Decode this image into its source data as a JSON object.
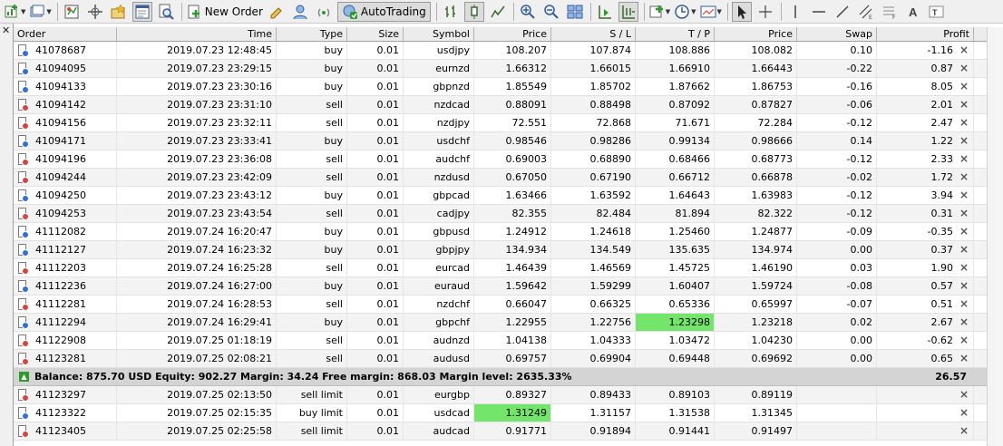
{
  "toolbar": {
    "new_order_label": "New Order",
    "autotrading_label": "AutoTrading"
  },
  "colors": {
    "buy_dot": "#2f6fd6",
    "sell_dot": "#d6453b",
    "highlight": "#72e56a"
  },
  "columns": [
    "Order",
    "Time",
    "Type",
    "Size",
    "Symbol",
    "Price",
    "S / L",
    "T / P",
    "Price",
    "Swap",
    "Profit"
  ],
  "orders": [
    {
      "order": "41078687",
      "time": "2019.07.23 12:48:45",
      "type": "buy",
      "size": "0.01",
      "symbol": "usdjpy",
      "price": "108.207",
      "sl": "107.874",
      "tp": "108.886",
      "price2": "108.082",
      "swap": "0.10",
      "profit": "-1.16"
    },
    {
      "order": "41094095",
      "time": "2019.07.23 23:29:15",
      "type": "buy",
      "size": "0.01",
      "symbol": "eurnzd",
      "price": "1.66312",
      "sl": "1.66015",
      "tp": "1.66910",
      "price2": "1.66443",
      "swap": "-0.22",
      "profit": "0.87"
    },
    {
      "order": "41094133",
      "time": "2019.07.23 23:30:16",
      "type": "buy",
      "size": "0.01",
      "symbol": "gbpnzd",
      "price": "1.85549",
      "sl": "1.85702",
      "tp": "1.87662",
      "price2": "1.86753",
      "swap": "-0.16",
      "profit": "8.05"
    },
    {
      "order": "41094142",
      "time": "2019.07.23 23:31:10",
      "type": "sell",
      "size": "0.01",
      "symbol": "nzdcad",
      "price": "0.88091",
      "sl": "0.88498",
      "tp": "0.87092",
      "price2": "0.87827",
      "swap": "-0.06",
      "profit": "2.01"
    },
    {
      "order": "41094156",
      "time": "2019.07.23 23:32:11",
      "type": "sell",
      "size": "0.01",
      "symbol": "nzdjpy",
      "price": "72.551",
      "sl": "72.868",
      "tp": "71.671",
      "price2": "72.284",
      "swap": "-0.12",
      "profit": "2.47"
    },
    {
      "order": "41094171",
      "time": "2019.07.23 23:33:41",
      "type": "buy",
      "size": "0.01",
      "symbol": "usdchf",
      "price": "0.98546",
      "sl": "0.98286",
      "tp": "0.99134",
      "price2": "0.98666",
      "swap": "0.14",
      "profit": "1.22"
    },
    {
      "order": "41094196",
      "time": "2019.07.23 23:36:08",
      "type": "sell",
      "size": "0.01",
      "symbol": "audchf",
      "price": "0.69003",
      "sl": "0.68890",
      "tp": "0.68466",
      "price2": "0.68773",
      "swap": "-0.12",
      "profit": "2.33"
    },
    {
      "order": "41094244",
      "time": "2019.07.23 23:42:09",
      "type": "sell",
      "size": "0.01",
      "symbol": "nzdusd",
      "price": "0.67050",
      "sl": "0.67190",
      "tp": "0.66712",
      "price2": "0.66878",
      "swap": "-0.02",
      "profit": "1.72"
    },
    {
      "order": "41094250",
      "time": "2019.07.23 23:43:12",
      "type": "buy",
      "size": "0.01",
      "symbol": "gbpcad",
      "price": "1.63466",
      "sl": "1.63592",
      "tp": "1.64643",
      "price2": "1.63983",
      "swap": "-0.12",
      "profit": "3.94"
    },
    {
      "order": "41094253",
      "time": "2019.07.23 23:43:54",
      "type": "sell",
      "size": "0.01",
      "symbol": "cadjpy",
      "price": "82.355",
      "sl": "82.484",
      "tp": "81.894",
      "price2": "82.322",
      "swap": "-0.12",
      "profit": "0.31"
    },
    {
      "order": "41112082",
      "time": "2019.07.24 16:20:47",
      "type": "buy",
      "size": "0.01",
      "symbol": "gbpusd",
      "price": "1.24912",
      "sl": "1.24618",
      "tp": "1.25460",
      "price2": "1.24877",
      "swap": "-0.09",
      "profit": "-0.35"
    },
    {
      "order": "41112127",
      "time": "2019.07.24 16:23:32",
      "type": "buy",
      "size": "0.01",
      "symbol": "gbpjpy",
      "price": "134.934",
      "sl": "134.549",
      "tp": "135.635",
      "price2": "134.974",
      "swap": "0.00",
      "profit": "0.37"
    },
    {
      "order": "41112203",
      "time": "2019.07.24 16:25:28",
      "type": "sell",
      "size": "0.01",
      "symbol": "eurcad",
      "price": "1.46439",
      "sl": "1.46569",
      "tp": "1.45725",
      "price2": "1.46190",
      "swap": "0.03",
      "profit": "1.90"
    },
    {
      "order": "41112236",
      "time": "2019.07.24 16:27:00",
      "type": "buy",
      "size": "0.01",
      "symbol": "euraud",
      "price": "1.59642",
      "sl": "1.59299",
      "tp": "1.60407",
      "price2": "1.59724",
      "swap": "-0.08",
      "profit": "0.57"
    },
    {
      "order": "41112281",
      "time": "2019.07.24 16:28:53",
      "type": "sell",
      "size": "0.01",
      "symbol": "nzdchf",
      "price": "0.66047",
      "sl": "0.66325",
      "tp": "0.65336",
      "price2": "0.65997",
      "swap": "-0.07",
      "profit": "0.51"
    },
    {
      "order": "41112294",
      "time": "2019.07.24 16:29:41",
      "type": "buy",
      "size": "0.01",
      "symbol": "gbpchf",
      "price": "1.22955",
      "sl": "1.22756",
      "tp": "1.23298",
      "price2": "1.23218",
      "swap": "0.02",
      "profit": "2.67",
      "hl": "tp"
    },
    {
      "order": "41122908",
      "time": "2019.07.25 01:18:19",
      "type": "sell",
      "size": "0.01",
      "symbol": "audnzd",
      "price": "1.04138",
      "sl": "1.04333",
      "tp": "1.03472",
      "price2": "1.04230",
      "swap": "0.00",
      "profit": "-0.62"
    },
    {
      "order": "41123281",
      "time": "2019.07.25 02:08:21",
      "type": "sell",
      "size": "0.01",
      "symbol": "audusd",
      "price": "0.69757",
      "sl": "0.69904",
      "tp": "0.69448",
      "price2": "0.69692",
      "swap": "0.00",
      "profit": "0.65"
    }
  ],
  "balance": {
    "text": "Balance: 875.70 USD  Equity: 902.27  Margin: 34.24  Free margin: 868.03  Margin level: 2635.33%",
    "profit": "26.57"
  },
  "pending": [
    {
      "order": "41123297",
      "time": "2019.07.25 02:13:50",
      "type": "sell limit",
      "size": "0.01",
      "symbol": "eurgbp",
      "price": "0.89327",
      "sl": "0.89433",
      "tp": "0.89103",
      "price2": "0.89119",
      "swap": "",
      "profit": ""
    },
    {
      "order": "41123322",
      "time": "2019.07.25 02:15:35",
      "type": "buy limit",
      "size": "0.01",
      "symbol": "usdcad",
      "price": "1.31249",
      "sl": "1.31157",
      "tp": "1.31538",
      "price2": "1.31345",
      "swap": "",
      "profit": "",
      "hl": "price"
    },
    {
      "order": "41123405",
      "time": "2019.07.25 02:25:58",
      "type": "sell limit",
      "size": "0.01",
      "symbol": "audcad",
      "price": "0.91771",
      "sl": "0.91894",
      "tp": "0.91441",
      "price2": "0.91497",
      "swap": "",
      "profit": ""
    }
  ]
}
